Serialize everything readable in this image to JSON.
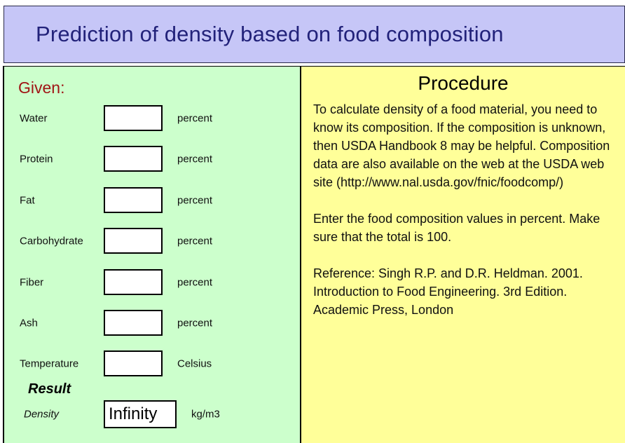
{
  "header": {
    "title": "Prediction of density based on food composition",
    "background_color": "#c6c6f7",
    "text_color": "#22227a"
  },
  "given_panel": {
    "heading": "Given:",
    "heading_color": "#a01515",
    "background_color": "#ccffcc",
    "fields": [
      {
        "label": "Water",
        "value": "",
        "placeholder": "",
        "unit": "percent"
      },
      {
        "label": "Protein",
        "value": "",
        "placeholder": "",
        "unit": "percent"
      },
      {
        "label": "Fat",
        "value": "",
        "placeholder": "",
        "unit": "percent"
      },
      {
        "label": "Carbohydrate",
        "value": "",
        "placeholder": "",
        "unit": "percent"
      },
      {
        "label": "Fiber",
        "value": "",
        "placeholder": "",
        "unit": "percent"
      },
      {
        "label": "Ash",
        "value": "",
        "placeholder": "",
        "unit": "percent"
      },
      {
        "label": "Temperature",
        "value": "",
        "placeholder": "",
        "unit": "Celsius"
      }
    ],
    "result": {
      "heading": "Result",
      "label": "Density",
      "value": "Infinity",
      "unit": "kg/m3"
    }
  },
  "procedure_panel": {
    "heading": "Procedure",
    "background_color": "#ffff99",
    "paragraphs": [
      "To calculate density of a food material, you need to know its composition. If the composition is unknown, then USDA Handbook 8 may be helpful. Composition data are also available on the web at the USDA web site (http://www.nal.usda.gov/fnic/foodcomp/)",
      "Enter the food composition values in percent. Make sure that the total is 100.",
      " Reference:  Singh R.P. and D.R. Heldman. 2001. Introduction to Food Engineering. 3rd Edition. Academic Press, London"
    ]
  }
}
